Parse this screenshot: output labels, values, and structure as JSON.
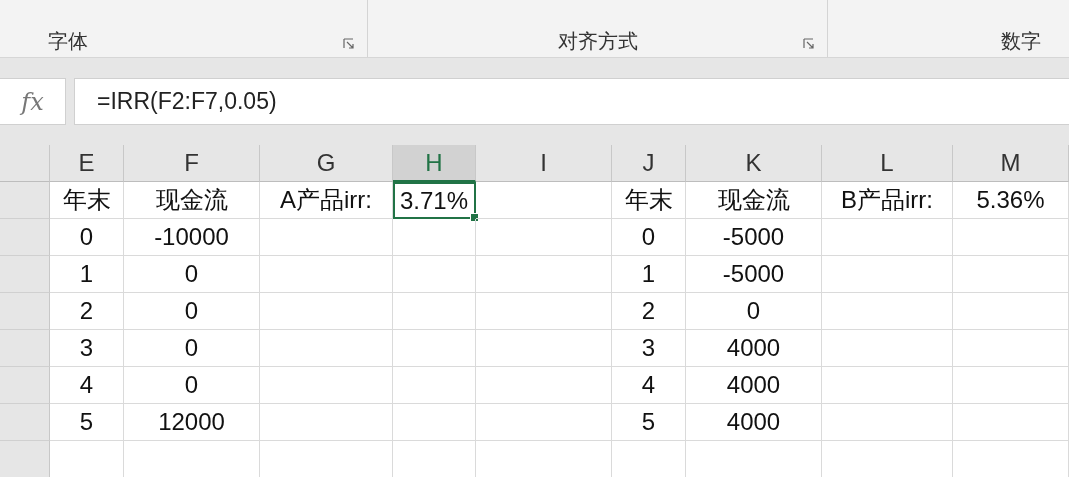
{
  "ribbon": {
    "groups": [
      {
        "label": "字体",
        "launcher": true
      },
      {
        "label": "对齐方式",
        "launcher": true
      },
      {
        "label": "数字"
      }
    ]
  },
  "formula_bar": {
    "fx": "fx",
    "formula": "=IRR(F2:F7,0.05)"
  },
  "sheet": {
    "columns": [
      {
        "label": "E",
        "selected": false
      },
      {
        "label": "F",
        "selected": false
      },
      {
        "label": "G",
        "selected": false
      },
      {
        "label": "H",
        "selected": true
      },
      {
        "label": "I",
        "selected": false
      },
      {
        "label": "J",
        "selected": false
      },
      {
        "label": "K",
        "selected": false
      },
      {
        "label": "L",
        "selected": false
      },
      {
        "label": "M",
        "selected": false
      }
    ],
    "rows": [
      [
        {
          "text": "年末",
          "selected": false
        },
        {
          "text": "现金流",
          "selected": false
        },
        {
          "text": "A产品irr:",
          "selected": false
        },
        {
          "text": "3.71%",
          "selected": true
        },
        {
          "selected": false
        },
        {
          "text": "年末",
          "selected": false
        },
        {
          "text": "现金流",
          "selected": false
        },
        {
          "text": "B产品irr:",
          "selected": false
        },
        {
          "text": "5.36%",
          "selected": false
        }
      ],
      [
        {
          "text": "0",
          "selected": false
        },
        {
          "text": "-10000",
          "selected": false
        },
        {
          "selected": false
        },
        {
          "selected": false
        },
        {
          "selected": false
        },
        {
          "text": "0",
          "selected": false
        },
        {
          "text": "-5000",
          "selected": false
        },
        {
          "selected": false
        },
        {
          "selected": false
        }
      ],
      [
        {
          "text": "1",
          "selected": false
        },
        {
          "text": "0",
          "selected": false
        },
        {
          "selected": false
        },
        {
          "selected": false
        },
        {
          "selected": false
        },
        {
          "text": "1",
          "selected": false
        },
        {
          "text": "-5000",
          "selected": false
        },
        {
          "selected": false
        },
        {
          "selected": false
        }
      ],
      [
        {
          "text": "2",
          "selected": false
        },
        {
          "text": "0",
          "selected": false
        },
        {
          "selected": false
        },
        {
          "selected": false
        },
        {
          "selected": false
        },
        {
          "text": "2",
          "selected": false
        },
        {
          "text": "0",
          "selected": false
        },
        {
          "selected": false
        },
        {
          "selected": false
        }
      ],
      [
        {
          "text": "3",
          "selected": false
        },
        {
          "text": "0",
          "selected": false
        },
        {
          "selected": false
        },
        {
          "selected": false
        },
        {
          "selected": false
        },
        {
          "text": "3",
          "selected": false
        },
        {
          "text": "4000",
          "selected": false
        },
        {
          "selected": false
        },
        {
          "selected": false
        }
      ],
      [
        {
          "text": "4",
          "selected": false
        },
        {
          "text": "0",
          "selected": false
        },
        {
          "selected": false
        },
        {
          "selected": false
        },
        {
          "selected": false
        },
        {
          "text": "4",
          "selected": false
        },
        {
          "text": "4000",
          "selected": false
        },
        {
          "selected": false
        },
        {
          "selected": false
        }
      ],
      [
        {
          "text": "5",
          "selected": false
        },
        {
          "text": "12000",
          "selected": false
        },
        {
          "selected": false
        },
        {
          "selected": false
        },
        {
          "selected": false
        },
        {
          "text": "5",
          "selected": false
        },
        {
          "text": "4000",
          "selected": false
        },
        {
          "selected": false
        },
        {
          "selected": false
        }
      ],
      [
        {
          "selected": false
        },
        {
          "selected": false
        },
        {
          "selected": false
        },
        {
          "selected": false
        },
        {
          "selected": false
        },
        {
          "selected": false
        },
        {
          "selected": false
        },
        {
          "selected": false
        },
        {
          "selected": false
        }
      ]
    ]
  }
}
